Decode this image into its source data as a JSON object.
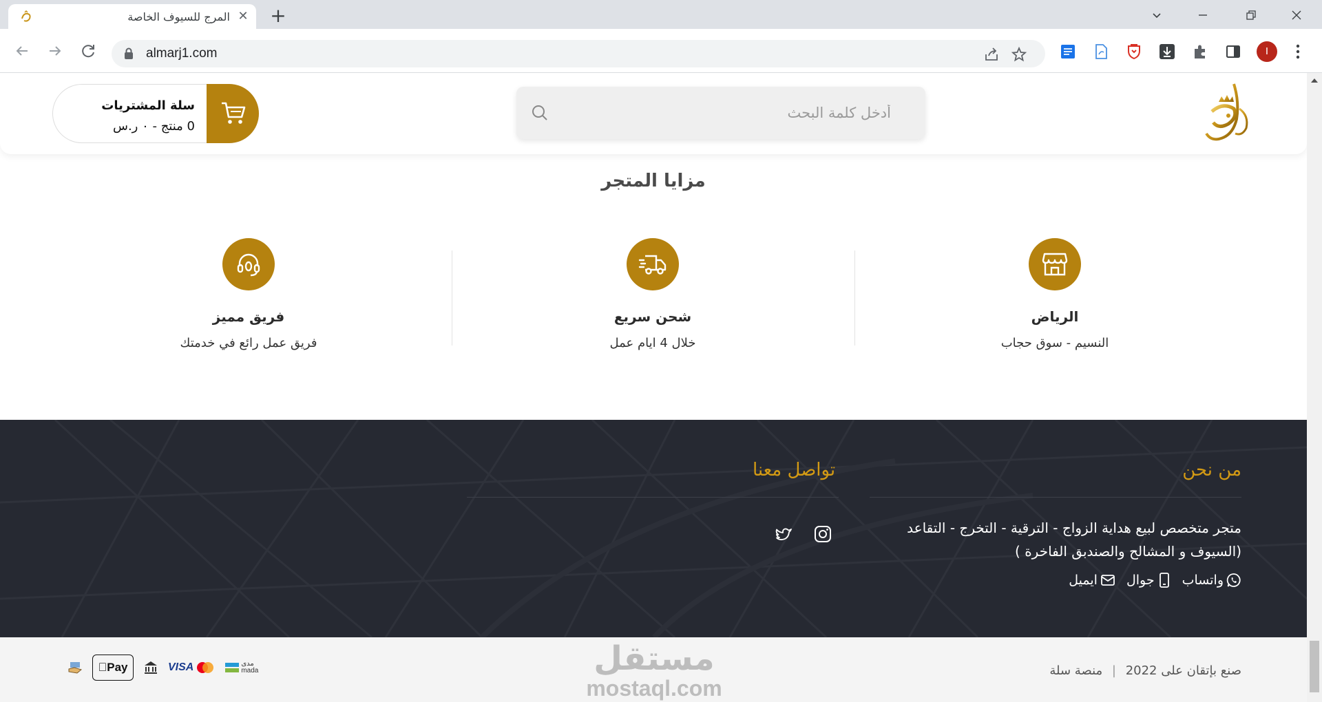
{
  "browser": {
    "tab_title": "المرج للسيوف الخاصة",
    "new_tab": "+",
    "url": "almarj1.com",
    "profile_initial": "I"
  },
  "header": {
    "search_placeholder": "أدخل كلمة البحث",
    "cart_title": "سلة المشتريات",
    "cart_summary": "0 منتج - ٠ ر.س"
  },
  "features": {
    "title": "مزايا المتجر",
    "items": [
      {
        "title": "الرياض",
        "desc": "النسيم - سوق حجاب",
        "icon": "store-icon"
      },
      {
        "title": "شحن سريع",
        "desc": "خلال 4 ايام عمل",
        "icon": "shipping-truck-icon"
      },
      {
        "title": "فريق مميز",
        "desc": "فريق عمل رائع في خدمتك",
        "icon": "support-headset-icon"
      }
    ]
  },
  "footer": {
    "about_title": "من نحن",
    "about_text": "متجر متخصص لبيع هداية الزواج - الترقية - التخرج - التقاعد (السيوف و المشالح والصندبق الفاخرة )",
    "contact_title": "تواصل معنا",
    "links": {
      "whatsapp": "واتساب",
      "mobile": "جوال",
      "email": "ايميل"
    },
    "social": [
      "instagram-icon",
      "twitter-icon"
    ],
    "copyright_made": "صنع بإتقان على",
    "copyright_platform": "منصة سلة",
    "copyright_year": "2022",
    "watermark_ar": "مستقل",
    "watermark_en": "mostaql.com",
    "payments": {
      "mada_ar": "مدى",
      "mada_en": "mada",
      "visa": "VISA",
      "applepay": "Pay"
    }
  },
  "colors": {
    "accent": "#b5820f",
    "footer_bg": "#262932",
    "footer_heading": "#d39a14"
  }
}
